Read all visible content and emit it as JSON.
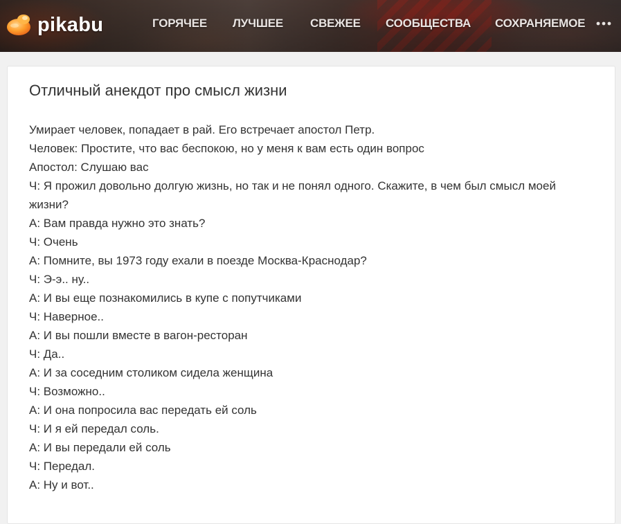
{
  "brand": {
    "name": "pikabu",
    "logo_icon": "pikabu-logo-icon"
  },
  "nav": {
    "items": [
      {
        "label": "ГОРЯЧЕЕ"
      },
      {
        "label": "ЛУЧШЕЕ"
      },
      {
        "label": "СВЕЖЕЕ"
      },
      {
        "label": "СООБЩЕСТВА"
      },
      {
        "label": "СОХРАНЯЕМОЕ"
      }
    ],
    "more_icon": "more-dots-icon"
  },
  "post": {
    "title": "Отличный анекдот про смысл жизни",
    "lines": [
      "Умирает человек, попадает в рай. Его встречает апостол Петр.",
      "Человек: Простите, что вас беспокою, но у меня к вам есть один вопрос",
      "Апостол: Слушаю вас",
      "Ч: Я прожил довольно долгую жизнь, но так и не понял одного. Скажите, в чем был смысл моей жизни?",
      "А: Вам правда нужно это знать?",
      "Ч: Очень",
      "А: Помните, вы 1973 году ехали в поезде Москва-Краснодар?",
      "Ч: Э-э.. ну..",
      "А: И вы еще познакомились в купе с попутчиками",
      "Ч: Наверное..",
      "А: И вы пошли вместе в вагон-ресторан",
      "Ч: Да..",
      "А: И за соседним столиком сидела женщина",
      "Ч: Возможно..",
      "А: И она попросила вас передать ей соль",
      "Ч: И я ей передал соль.",
      "А: И вы передали ей соль",
      "Ч: Передал.",
      "А: Ну и вот.."
    ]
  },
  "colors": {
    "accent": "#ff9e2c",
    "text": "#333333",
    "nav_text": "#e9e4e2",
    "page_bg": "#f1f1f1"
  }
}
